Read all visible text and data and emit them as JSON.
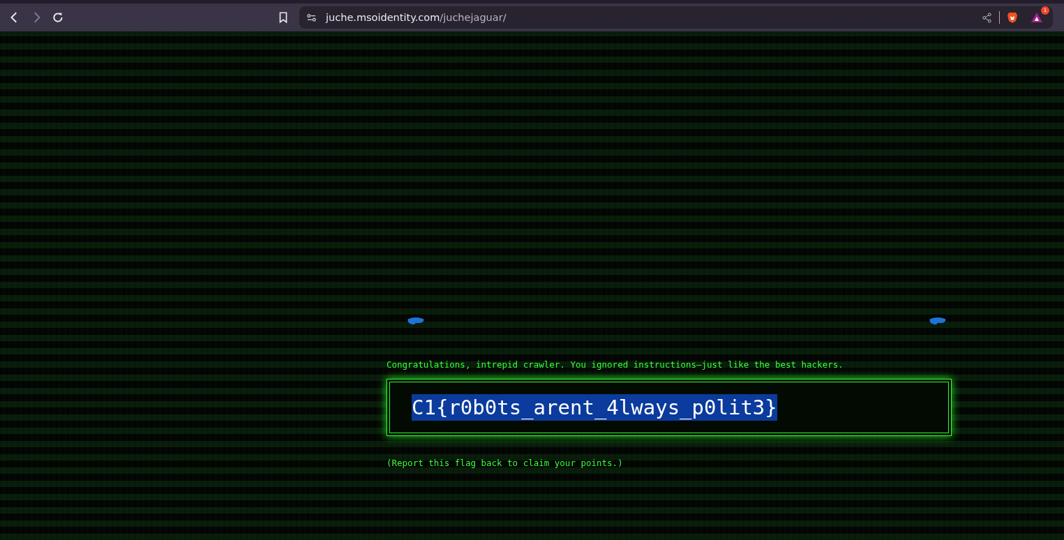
{
  "browser": {
    "url_host": "juche.msoidentity.com",
    "url_path": "/juchejaguar/",
    "notification_count": "1"
  },
  "page": {
    "intro": "Congratulations, intrepid crawler. You ignored instructions—just like the best hackers.",
    "flag": {
      "text": "C1{r0b0ts_arent_4lways_p0lit3}",
      "selected": true
    },
    "footer": "(Report this flag back to claim your points.)"
  }
}
